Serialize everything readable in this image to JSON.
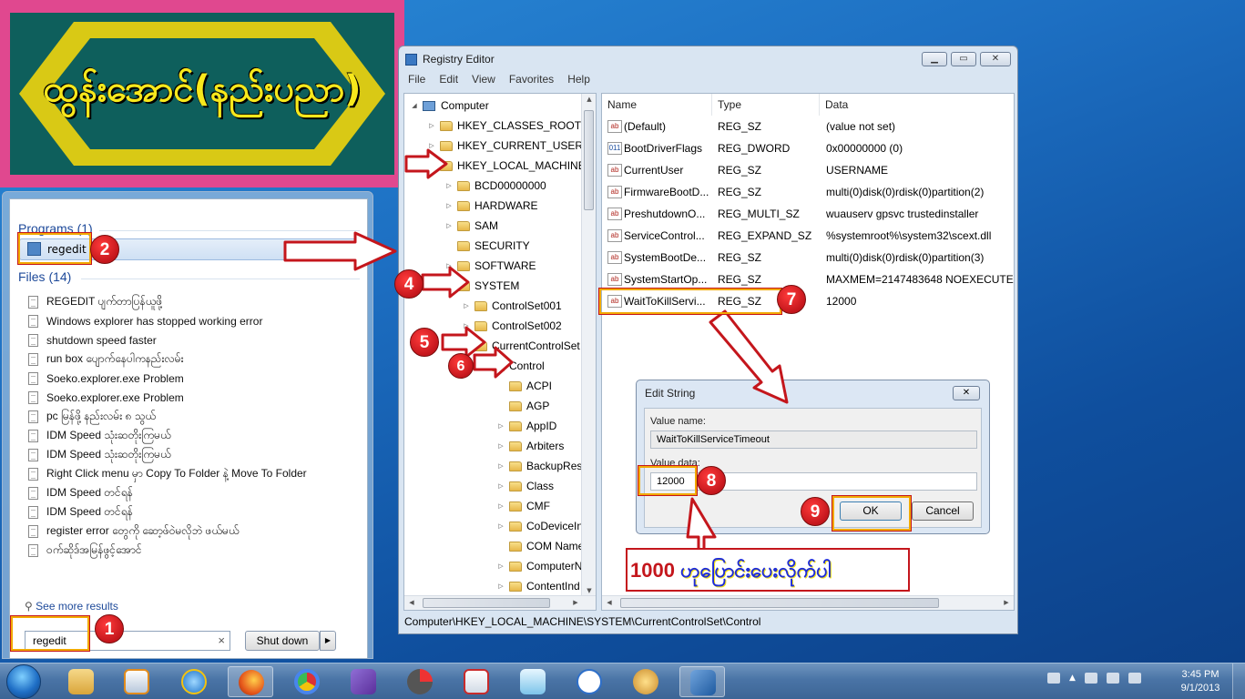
{
  "banner": {
    "text": "ထွန်းအောင်(နည်းပညာ)"
  },
  "start_menu": {
    "programs_heading": "Programs (1)",
    "program_item": "regedit",
    "files_heading": "Files (14)",
    "files": [
      "REGEDIT ပျက်တာပြန်ယူဖို့",
      "Windows explorer has stopped working error",
      "shutdown speed faster",
      "run box ပျောက်နေပါကနည်းလမ်း",
      "Soeko.explorer.exe Problem",
      "Soeko.explorer.exe Problem",
      "pc မြန်ဖို့ နည်းလမ်း ၈ သွယ်",
      "IDM Speed သုံးဆတိုးကြမယ်",
      "IDM Speed သုံးဆတိုးကြမယ်",
      "Right Click menu မှာ Copy To Folder နဲ့ Move To Folder",
      "IDM Speed တင်ရန်",
      "IDM Speed တင်ရန်",
      "register error တွေကို ဆော့ဖ်ဝဲမလိုဘဲ ဖယ်မယ်",
      "ဝက်ဆိုဒ်အမြန်ဖွင့်အောင်"
    ],
    "see_more": "See more results",
    "search_value": "regedit",
    "shutdown_label": "Shut down"
  },
  "regedit": {
    "title": "Registry Editor",
    "menu": [
      "File",
      "Edit",
      "View",
      "Favorites",
      "Help"
    ],
    "tree": [
      {
        "label": "Computer",
        "indent": 0,
        "twisty": "◢",
        "icon": "computer"
      },
      {
        "label": "HKEY_CLASSES_ROOT",
        "indent": 1,
        "twisty": "▷"
      },
      {
        "label": "HKEY_CURRENT_USER",
        "indent": 1,
        "twisty": "▷"
      },
      {
        "label": "HKEY_LOCAL_MACHINE",
        "indent": 1,
        "twisty": "◢"
      },
      {
        "label": "BCD00000000",
        "indent": 2,
        "twisty": "▷"
      },
      {
        "label": "HARDWARE",
        "indent": 2,
        "twisty": "▷"
      },
      {
        "label": "SAM",
        "indent": 2,
        "twisty": "▷"
      },
      {
        "label": "SECURITY",
        "indent": 2,
        "twisty": ""
      },
      {
        "label": "SOFTWARE",
        "indent": 2,
        "twisty": "▷"
      },
      {
        "label": "SYSTEM",
        "indent": 2,
        "twisty": "◢"
      },
      {
        "label": "ControlSet001",
        "indent": 3,
        "twisty": "▷"
      },
      {
        "label": "ControlSet002",
        "indent": 3,
        "twisty": "▷"
      },
      {
        "label": "CurrentControlSet",
        "indent": 3,
        "twisty": "◢"
      },
      {
        "label": "Control",
        "indent": 4,
        "twisty": "◢"
      },
      {
        "label": "ACPI",
        "indent": 5,
        "twisty": ""
      },
      {
        "label": "AGP",
        "indent": 5,
        "twisty": ""
      },
      {
        "label": "AppID",
        "indent": 5,
        "twisty": "▷"
      },
      {
        "label": "Arbiters",
        "indent": 5,
        "twisty": "▷"
      },
      {
        "label": "BackupRest",
        "indent": 5,
        "twisty": "▷"
      },
      {
        "label": "Class",
        "indent": 5,
        "twisty": "▷"
      },
      {
        "label": "CMF",
        "indent": 5,
        "twisty": "▷"
      },
      {
        "label": "CoDeviceIn",
        "indent": 5,
        "twisty": "▷"
      },
      {
        "label": "COM Name",
        "indent": 5,
        "twisty": ""
      },
      {
        "label": "ComputerN",
        "indent": 5,
        "twisty": "▷"
      },
      {
        "label": "ContentInd",
        "indent": 5,
        "twisty": "▷"
      }
    ],
    "columns": {
      "name": "Name",
      "type": "Type",
      "data": "Data"
    },
    "values": [
      {
        "name": "(Default)",
        "type": "REG_SZ",
        "data": "(value not set)",
        "icon": "ab"
      },
      {
        "name": "BootDriverFlags",
        "type": "REG_DWORD",
        "data": "0x00000000 (0)",
        "icon": "bin"
      },
      {
        "name": "CurrentUser",
        "type": "REG_SZ",
        "data": "USERNAME",
        "icon": "ab"
      },
      {
        "name": "FirmwareBootD...",
        "type": "REG_SZ",
        "data": "multi(0)disk(0)rdisk(0)partition(2)",
        "icon": "ab"
      },
      {
        "name": "PreshutdownO...",
        "type": "REG_MULTI_SZ",
        "data": "wuauserv gpsvc trustedinstaller",
        "icon": "ab"
      },
      {
        "name": "ServiceControl...",
        "type": "REG_EXPAND_SZ",
        "data": "%systemroot%\\system32\\scext.dll",
        "icon": "ab"
      },
      {
        "name": "SystemBootDe...",
        "type": "REG_SZ",
        "data": "multi(0)disk(0)rdisk(0)partition(3)",
        "icon": "ab"
      },
      {
        "name": "SystemStartOp...",
        "type": "REG_SZ",
        "data": " MAXMEM=2147483648  NOEXECUTE",
        "icon": "ab"
      },
      {
        "name": "WaitToKillServi...",
        "type": "REG_SZ",
        "data": "12000",
        "icon": "ab"
      }
    ],
    "status": "Computer\\HKEY_LOCAL_MACHINE\\SYSTEM\\CurrentControlSet\\Control"
  },
  "dialog": {
    "title": "Edit String",
    "value_name_label": "Value name:",
    "value_name": "WaitToKillServiceTimeout",
    "value_data_label": "Value data:",
    "value_data": "12000",
    "ok": "OK",
    "cancel": "Cancel"
  },
  "annotations": {
    "badges": [
      "1",
      "2",
      "4",
      "5",
      "6",
      "7",
      "8",
      "9"
    ],
    "note_number": "1000",
    "note_text": " ဟုပြောင်းပေးလိုက်ပါ"
  },
  "taskbar": {
    "time": "3:45 PM",
    "date": "9/1/2013"
  },
  "colors": {
    "accent": "#c4161c",
    "highlight": "#f2a900",
    "banner_bg": "#e0488f",
    "banner_inner": "#0e5f5c",
    "banner_text": "#f7e81c"
  }
}
